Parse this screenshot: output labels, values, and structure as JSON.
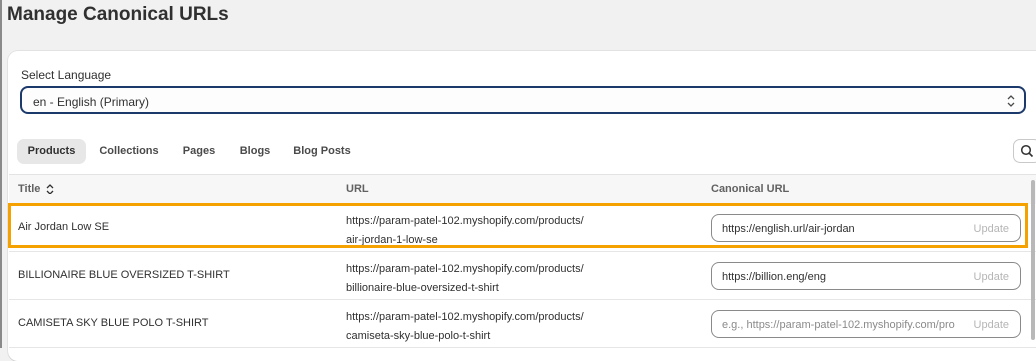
{
  "page": {
    "title": "Manage Canonical URLs"
  },
  "language": {
    "label": "Select Language",
    "selected": "en - English (Primary)"
  },
  "tabs": [
    {
      "label": "Products",
      "active": true
    },
    {
      "label": "Collections",
      "active": false
    },
    {
      "label": "Pages",
      "active": false
    },
    {
      "label": "Blogs",
      "active": false
    },
    {
      "label": "Blog Posts",
      "active": false
    }
  ],
  "table": {
    "headers": {
      "title": "Title",
      "url": "URL",
      "canonical": "Canonical URL"
    },
    "rows": [
      {
        "title": "Air Jordan Low SE",
        "url_line1": "https://param-patel-102.myshopify.com/products/",
        "url_line2": "air-jordan-1-low-se",
        "canonical_value": "https://english.url/air-jordan",
        "canonical_placeholder": "",
        "update_label": "Update"
      },
      {
        "title": "BILLIONAIRE BLUE OVERSIZED T-SHIRT",
        "url_line1": "https://param-patel-102.myshopify.com/products/",
        "url_line2": "billionaire-blue-oversized-t-shirt",
        "canonical_value": "https://billion.eng/eng",
        "canonical_placeholder": "",
        "update_label": "Update"
      },
      {
        "title": "CAMISETA SKY BLUE POLO T-SHIRT",
        "url_line1": "https://param-patel-102.myshopify.com/products/",
        "url_line2": "camiseta-sky-blue-polo-t-shirt",
        "canonical_value": "",
        "canonical_placeholder": "e.g., https://param-patel-102.myshopify.com/pro",
        "update_label": "Update"
      }
    ]
  },
  "colors": {
    "highlight": "#f5a100",
    "select_border": "#1b3a6b"
  },
  "icons": {
    "sort": "sort-icon",
    "search": "search-icon",
    "select": "chevron-updown-icon"
  }
}
